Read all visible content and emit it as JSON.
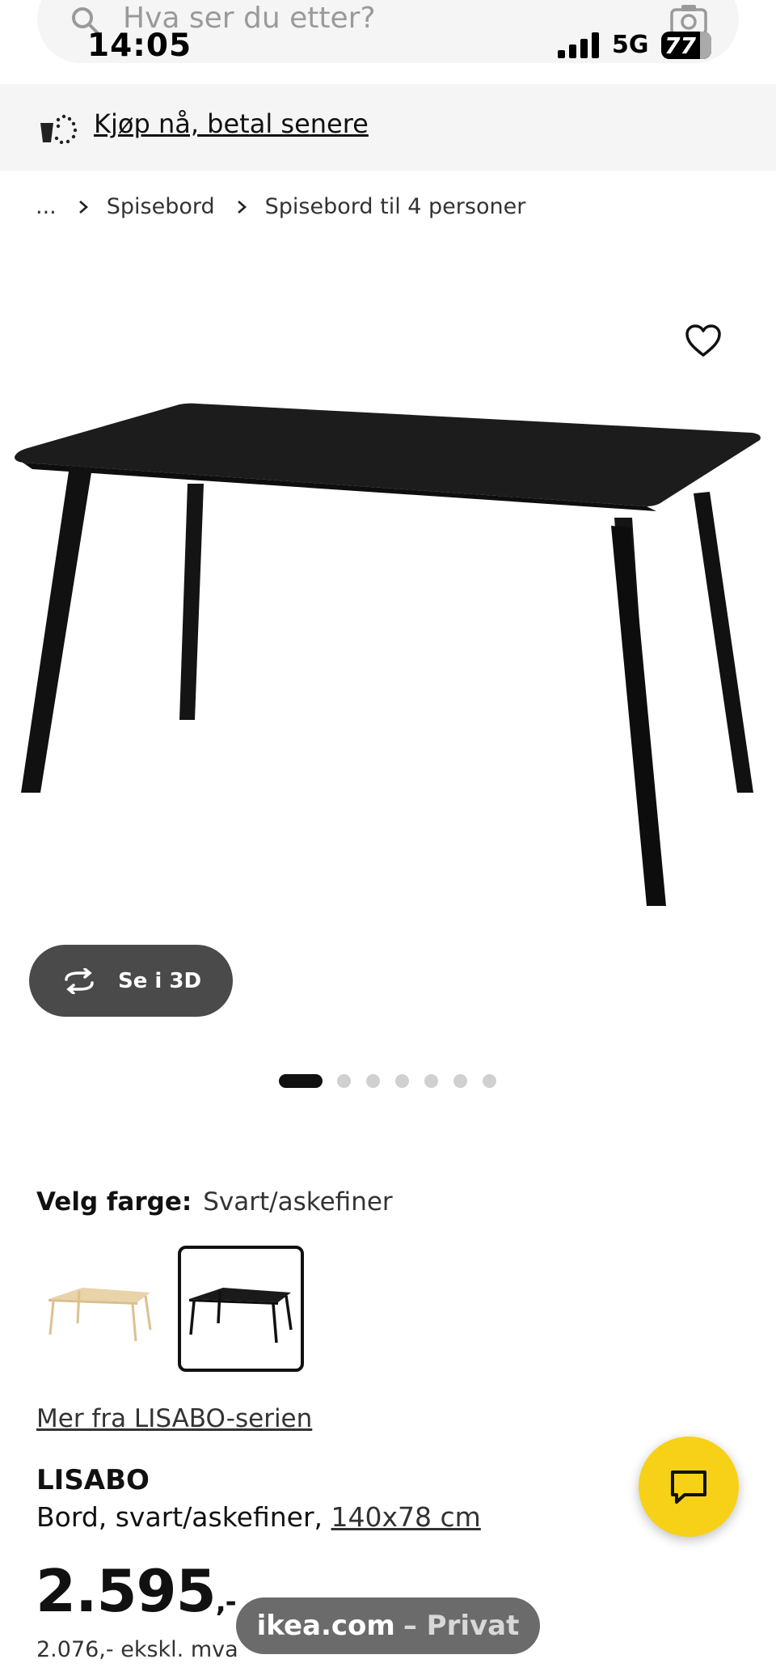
{
  "status_bar": {
    "time": "14:05",
    "network": "5G",
    "battery": "77"
  },
  "search": {
    "placeholder": "Hva ser du etter?",
    "icons": [
      "search-icon",
      "camera-icon"
    ]
  },
  "promo": {
    "link_label": "Kjøp nå, betal senere",
    "icon": "basket-icon"
  },
  "breadcrumb": {
    "items": [
      "...",
      "Spisebord",
      "Spisebord til 4 personer"
    ]
  },
  "product_gallery": {
    "view_3d_label": "Se i 3D",
    "slide_count": 7,
    "active_slide": 1,
    "favourite_icon": "heart-outline-icon"
  },
  "colour": {
    "label": "Velg farge:",
    "selected_value": "Svart/askefiner",
    "options": [
      "ash-veneer",
      "black-ash-veneer"
    ]
  },
  "series_link": "Mer fra LISABO-serien",
  "product": {
    "name": "LISABO",
    "description": "Bord, svart/askefiner,",
    "size": "140x78 cm",
    "price": "2.595",
    "price_suffix": ",-",
    "price_ex_vat": "2.076,- ekskl. mva"
  },
  "browser": {
    "domain": "ikea.com",
    "mode": "– Privat"
  },
  "colors": {
    "chat_button": "#f7d117",
    "banner_bg": "#f5f5f5",
    "view_3d_bg": "#4a4a4a"
  }
}
